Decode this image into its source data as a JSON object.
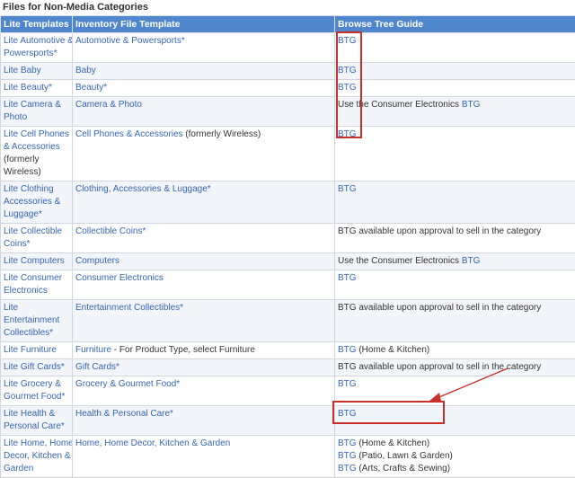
{
  "page_title": "Files for Non-Media Categories",
  "headers": [
    "Lite Templates",
    "Inventory File Template",
    "Browse Tree Guide"
  ],
  "rows": [
    {
      "lite": [
        "Lite Automotive &",
        "Powersports*"
      ],
      "inventory": "Automotive & Powersports*",
      "inventory_note": "",
      "browse": [
        {
          "pre": "",
          "link": "BTG",
          "post": ""
        }
      ]
    },
    {
      "lite": [
        "Lite Baby"
      ],
      "inventory": "Baby",
      "inventory_note": "",
      "browse": [
        {
          "pre": "",
          "link": "BTG",
          "post": ""
        }
      ]
    },
    {
      "lite": [
        "Lite Beauty*"
      ],
      "inventory": "Beauty*",
      "inventory_note": "",
      "browse": [
        {
          "pre": "",
          "link": "BTG",
          "post": ""
        }
      ]
    },
    {
      "lite": [
        "Lite Camera &",
        "Photo"
      ],
      "inventory": "Camera & Photo",
      "inventory_note": "",
      "browse": [
        {
          "pre": "Use the Consumer Electronics ",
          "link": "BTG",
          "post": ""
        }
      ]
    },
    {
      "lite": [
        "Lite Cell Phones",
        "& Accessories",
        "(formerly",
        "Wireless)"
      ],
      "inventory": "Cell Phones & Accessories",
      "inventory_note": " (formerly Wireless)",
      "browse": [
        {
          "pre": "",
          "link": "BTG",
          "post": ""
        }
      ]
    },
    {
      "lite": [
        "Lite Clothing",
        "Accessories &",
        "Luggage*"
      ],
      "inventory": "Clothing, Accessories & Luggage*",
      "inventory_note": "",
      "browse": [
        {
          "pre": "",
          "link": "BTG",
          "post": ""
        }
      ]
    },
    {
      "lite": [
        "Lite Collectible",
        "Coins*"
      ],
      "inventory": "Collectible Coins*",
      "inventory_note": "",
      "browse": [
        {
          "pre": "BTG available upon approval to sell in the category",
          "link": "",
          "post": ""
        }
      ]
    },
    {
      "lite": [
        "Lite Computers"
      ],
      "inventory": "Computers",
      "inventory_note": "",
      "browse": [
        {
          "pre": "Use the Consumer Electronics ",
          "link": "BTG",
          "post": ""
        }
      ]
    },
    {
      "lite": [
        "Lite Consumer",
        "Electronics"
      ],
      "inventory": "Consumer Electronics",
      "inventory_note": "",
      "browse": [
        {
          "pre": "",
          "link": "BTG",
          "post": ""
        }
      ]
    },
    {
      "lite": [
        "Lite",
        "Entertainment",
        "Collectibles*"
      ],
      "inventory": "Entertainment Collectibles*",
      "inventory_note": "",
      "browse": [
        {
          "pre": "BTG available upon approval to sell in the category",
          "link": "",
          "post": ""
        }
      ]
    },
    {
      "lite": [
        "Lite Furniture"
      ],
      "inventory": "Furniture",
      "inventory_note": " - For Product Type, select Furniture",
      "browse": [
        {
          "pre": "",
          "link": "BTG",
          "post": " (Home & Kitchen)"
        }
      ]
    },
    {
      "lite": [
        "Lite Gift Cards*"
      ],
      "inventory": "Gift Cards*",
      "inventory_note": "",
      "browse": [
        {
          "pre": "BTG available upon approval to sell in the category",
          "link": "",
          "post": ""
        }
      ]
    },
    {
      "lite": [
        "Lite Grocery &",
        "Gourmet Food*"
      ],
      "inventory": "Grocery & Gourmet Food*",
      "inventory_note": "",
      "browse": [
        {
          "pre": "",
          "link": "BTG",
          "post": ""
        }
      ]
    },
    {
      "lite": [
        "Lite Health &",
        "Personal Care*"
      ],
      "inventory": "Health & Personal Care*",
      "inventory_note": "",
      "browse": [
        {
          "pre": "",
          "link": "BTG",
          "post": ""
        }
      ]
    },
    {
      "lite": [
        "Lite Home, Home",
        "Decor, Kitchen &",
        "Garden"
      ],
      "inventory": "Home, Home Decor, Kitchen & Garden",
      "inventory_note": "",
      "browse": [
        {
          "pre": "",
          "link": "BTG",
          "post": " (Home & Kitchen)"
        },
        {
          "pre": "",
          "link": "BTG",
          "post": " (Patio, Lawn & Garden)"
        },
        {
          "pre": "",
          "link": "BTG",
          "post": " (Arts, Crafts & Sewing)"
        }
      ]
    }
  ],
  "annotation_color": "#c8302c"
}
